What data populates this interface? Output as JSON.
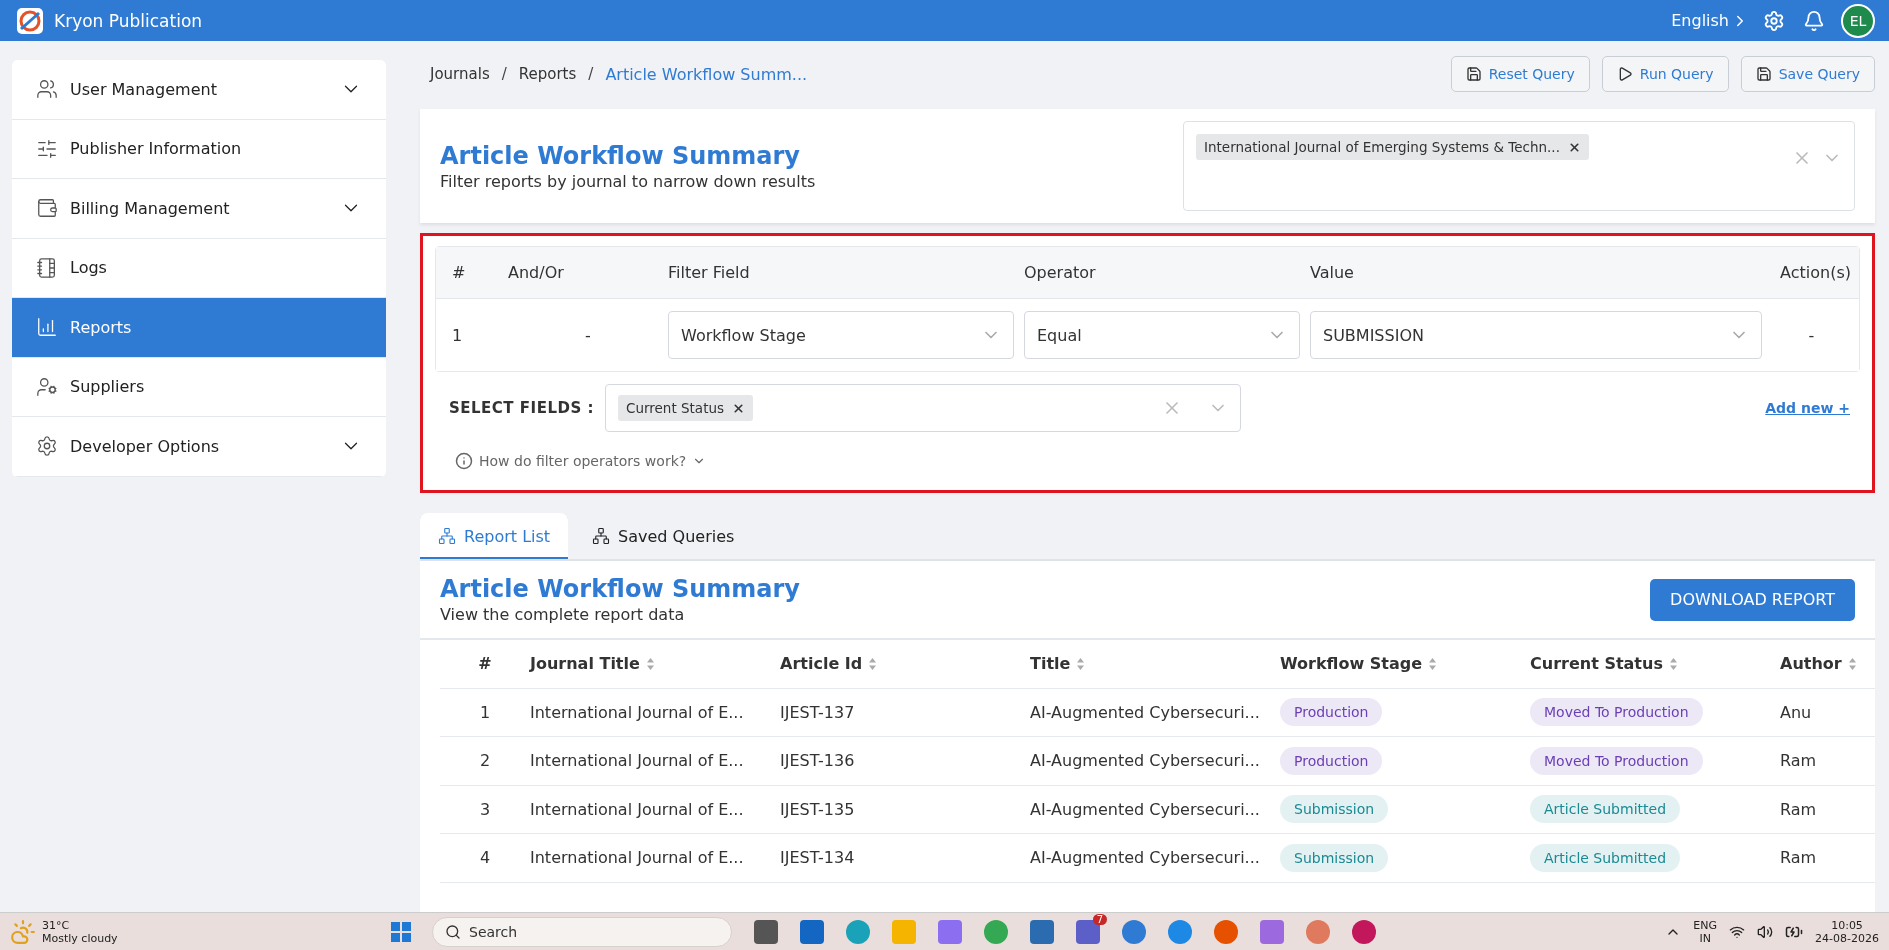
{
  "app_bar": {
    "brand": "Kryon Publication",
    "language": "English",
    "avatar": "EL"
  },
  "sidebar": {
    "items": [
      {
        "label": "User Management",
        "expandable": true,
        "selected": false
      },
      {
        "label": "Publisher Information",
        "expandable": false,
        "selected": false
      },
      {
        "label": "Billing Management",
        "expandable": true,
        "selected": false
      },
      {
        "label": "Logs",
        "expandable": false,
        "selected": false
      },
      {
        "label": "Reports",
        "expandable": false,
        "selected": true
      },
      {
        "label": "Suppliers",
        "expandable": false,
        "selected": false
      },
      {
        "label": "Developer Options",
        "expandable": true,
        "selected": false
      }
    ]
  },
  "breadcrumb": [
    {
      "kind": "link",
      "text": "Journals"
    },
    {
      "kind": "separator",
      "text": "/"
    },
    {
      "kind": "link",
      "text": "Reports"
    },
    {
      "kind": "separator",
      "text": "/"
    },
    {
      "kind": "current",
      "text": "Article Workflow Summ..."
    }
  ],
  "actions": [
    "Reset Query",
    "Run Query",
    "Save Query"
  ],
  "header": {
    "title": "Article Workflow Summary",
    "subtitle": "Filter reports by journal to narrow down results",
    "journal_chips": [
      "International Journal of Emerging Systems & Techn..."
    ]
  },
  "filters": {
    "columns": [
      "#",
      "And/Or",
      "Filter Field",
      "Operator",
      "Value",
      "Action(s)"
    ],
    "rows": [
      {
        "index": "1",
        "and_or": "-",
        "field": "Workflow Stage",
        "operator": "Equal",
        "value": "SUBMISSION",
        "action": "-"
      }
    ],
    "select_fields_label": "SELECT FIELDS :",
    "selected_fields": [
      "Current Status"
    ],
    "add_new": "Add new +",
    "help": "How do filter operators work?"
  },
  "tabs": [
    {
      "label": "Report List",
      "selected": true
    },
    {
      "label": "Saved Queries",
      "selected": false
    }
  ],
  "report": {
    "title": "Article Workflow Summary",
    "subtitle": "View the complete report data",
    "download": "DOWNLOAD REPORT",
    "columns": [
      {
        "label": "#",
        "sortable": false
      },
      {
        "label": "Journal Title",
        "sortable": true
      },
      {
        "label": "Article Id",
        "sortable": true
      },
      {
        "label": "Title",
        "sortable": true
      },
      {
        "label": "Workflow Stage",
        "sortable": true
      },
      {
        "label": "Current Status",
        "sortable": true
      },
      {
        "label": "Author",
        "sortable": true
      }
    ],
    "rows": [
      {
        "index": "1",
        "journal": "International Journal of E...",
        "article_id": "IJEST-137",
        "title": "AI-Augmented Cybersecuri...",
        "stage": {
          "label": "Production",
          "color": "#6a3fb5"
        },
        "status": {
          "label": "Moved To Production",
          "color": "#6a3fb5"
        },
        "author": "Anu"
      },
      {
        "index": "2",
        "journal": "International Journal of E...",
        "article_id": "IJEST-136",
        "title": "AI-Augmented Cybersecuri...",
        "stage": {
          "label": "Production",
          "color": "#6a3fb5"
        },
        "status": {
          "label": "Moved To Production",
          "color": "#6a3fb5"
        },
        "author": "Ram"
      },
      {
        "index": "3",
        "journal": "International Journal of E...",
        "article_id": "IJEST-135",
        "title": "AI-Augmented Cybersecuri...",
        "stage": {
          "label": "Submission",
          "color": "#1a8a93"
        },
        "status": {
          "label": "Article Submitted",
          "color": "#1a8a93"
        },
        "author": "Ram"
      },
      {
        "index": "4",
        "journal": "International Journal of E...",
        "article_id": "IJEST-134",
        "title": "AI-Augmented Cybersecuri...",
        "stage": {
          "label": "Submission",
          "color": "#1a8a93"
        },
        "status": {
          "label": "Article Submitted",
          "color": "#1a8a93"
        },
        "author": "Ram"
      }
    ]
  },
  "taskbar": {
    "temperature": "31°C",
    "weather": "Mostly cloudy",
    "search": "Search",
    "badge": "7",
    "language": "ENG",
    "region": "IN",
    "time": "10:05",
    "date": "24-08-2026"
  }
}
